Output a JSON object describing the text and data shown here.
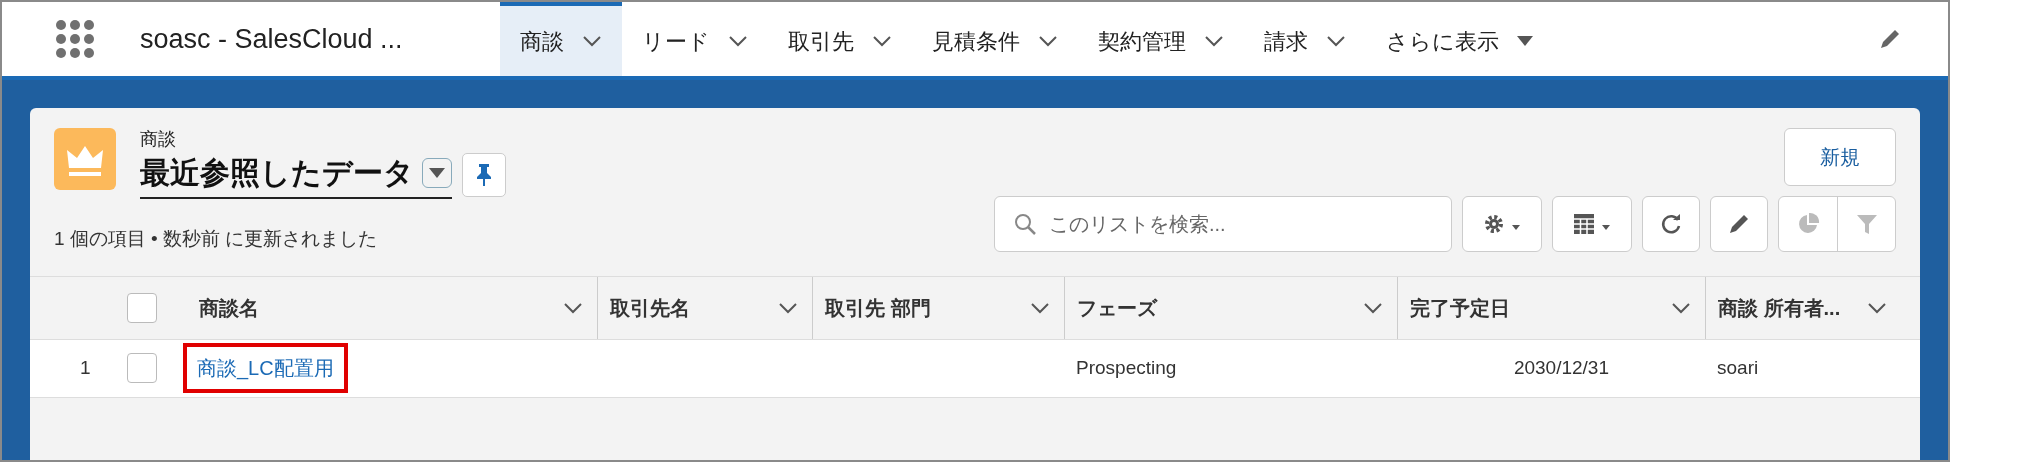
{
  "app": {
    "name": "soasc - SalesCloud ..."
  },
  "nav_tabs": [
    {
      "label": "商談",
      "selected": true,
      "kind": "chevron"
    },
    {
      "label": "リード",
      "selected": false,
      "kind": "chevron"
    },
    {
      "label": "取引先",
      "selected": false,
      "kind": "chevron"
    },
    {
      "label": "見積条件",
      "selected": false,
      "kind": "chevron"
    },
    {
      "label": "契約管理",
      "selected": false,
      "kind": "chevron"
    },
    {
      "label": "請求",
      "selected": false,
      "kind": "chevron"
    },
    {
      "label": "さらに表示",
      "selected": false,
      "kind": "triangle"
    }
  ],
  "list_header": {
    "object": "商談",
    "view_name": "最近参照したデータ",
    "status": "1 個の項目 • 数秒前 に更新されました"
  },
  "new_button": "新規",
  "search": {
    "placeholder": "このリストを検索..."
  },
  "toolbar": [
    {
      "kind": "gear",
      "disabled": false
    },
    {
      "kind": "table",
      "disabled": false
    },
    {
      "kind": "refresh",
      "disabled": false
    },
    {
      "kind": "edit",
      "disabled": false
    },
    {
      "kind": "chart",
      "disabled": true
    },
    {
      "kind": "filter",
      "disabled": true
    }
  ],
  "table": {
    "all_checked": false,
    "columns": [
      {
        "label": "商談名"
      },
      {
        "label": "取引先名"
      },
      {
        "label": "取引先 部門"
      },
      {
        "label": "フェーズ"
      },
      {
        "label": "完了予定日"
      },
      {
        "label": "商談 所有者..."
      }
    ],
    "rows": [
      {
        "number": "1",
        "checked": false,
        "highlighted": true,
        "name": "商談_LC配置用",
        "phase": "Prospecting",
        "close_date": "2030/12/31",
        "owner": "soari"
      }
    ]
  }
}
